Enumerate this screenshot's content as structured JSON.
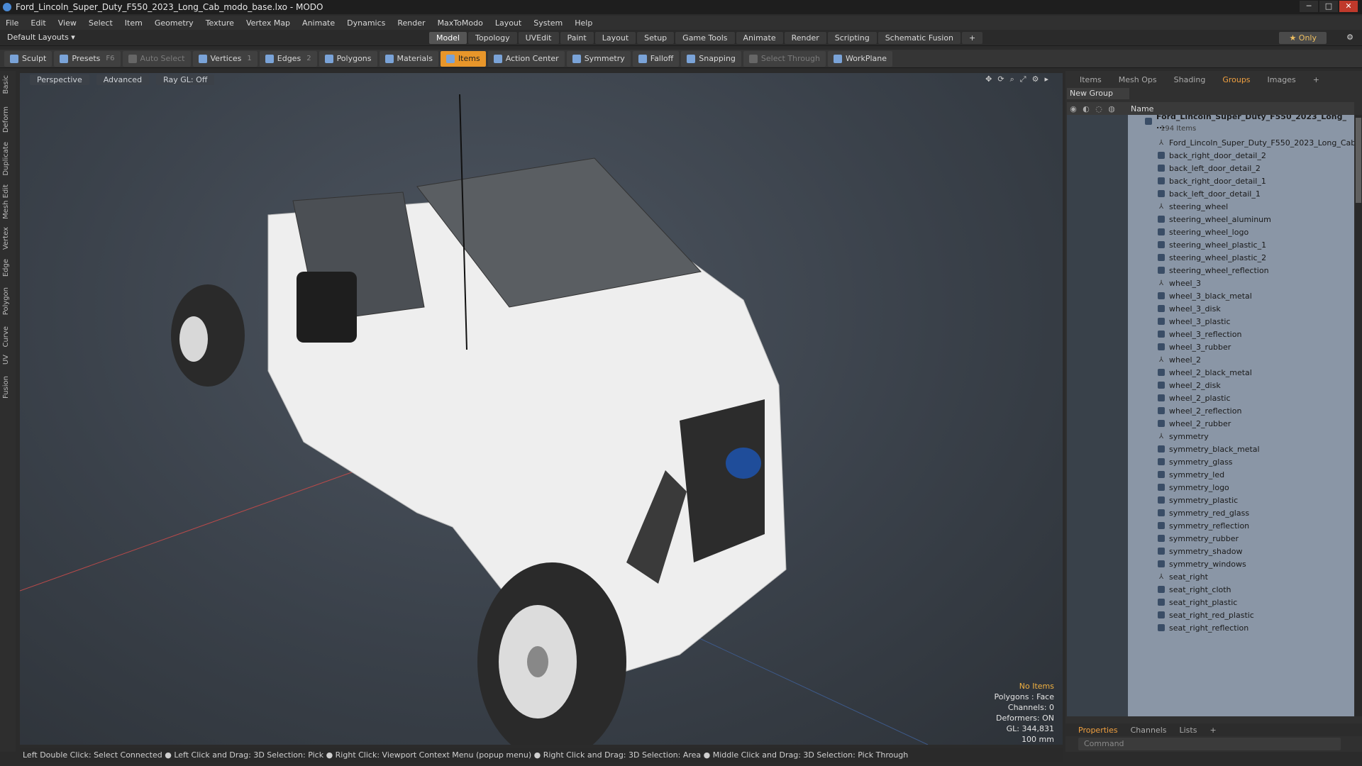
{
  "window": {
    "title": "Ford_Lincoln_Super_Duty_F550_2023_Long_Cab_modo_base.lxo - MODO"
  },
  "menu": [
    "File",
    "Edit",
    "View",
    "Select",
    "Item",
    "Geometry",
    "Texture",
    "Vertex Map",
    "Animate",
    "Dynamics",
    "Render",
    "MaxToModo",
    "Layout",
    "System",
    "Help"
  ],
  "layout": {
    "name": "Default Layouts ▾",
    "tabs": [
      "Model",
      "Topology",
      "UVEdit",
      "Paint",
      "Layout",
      "Setup",
      "Game Tools",
      "Animate",
      "Render",
      "Scripting",
      "Schematic Fusion",
      "+"
    ],
    "active": "Model",
    "only": "★ Only"
  },
  "toolbar": {
    "sculpt": "Sculpt",
    "presets": "Presets",
    "presets_key": "F6",
    "auto_select": "Auto Select",
    "vertices": "Vertices",
    "vertices_key": "1",
    "edges": "Edges",
    "edges_key": "2",
    "polygons": "Polygons",
    "materials": "Materials",
    "items": "Items",
    "action_center": "Action Center",
    "symmetry": "Symmetry",
    "falloff": "Falloff",
    "snapping": "Snapping",
    "select_through": "Select Through",
    "workplane": "WorkPlane"
  },
  "left_tabs": [
    "Basic",
    "Deform",
    "Duplicate",
    "Mesh Edit",
    "Vertex",
    "Edge",
    "Polygon",
    "Curve",
    "UV",
    "Fusion"
  ],
  "viewport": {
    "view": "Perspective",
    "shading": "Advanced",
    "raygl": "Ray GL: Off",
    "hud": {
      "sel": "No Items",
      "polys": "Polygons : Face",
      "channels": "Channels: 0",
      "deformers": "Deformers: ON",
      "gl": "GL: 344,831",
      "scale": "100 mm"
    }
  },
  "panel": {
    "tabs": [
      "Items",
      "Mesh Ops",
      "Shading",
      "Groups",
      "Images",
      "+"
    ],
    "active_tab": "Groups",
    "new_group": "New Group",
    "name_header": "Name",
    "root": {
      "name": "Ford_Lincoln_Super_Duty_F550_2023_Long_ ...",
      "count": "194 Items"
    },
    "items": [
      "Ford_Lincoln_Super_Duty_F550_2023_Long_Cab",
      "back_right_door_detail_2",
      "back_left_door_detail_2",
      "back_right_door_detail_1",
      "back_left_door_detail_1",
      "steering_wheel",
      "steering_wheel_aluminum",
      "steering_wheel_logo",
      "steering_wheel_plastic_1",
      "steering_wheel_plastic_2",
      "steering_wheel_reflection",
      "wheel_3",
      "wheel_3_black_metal",
      "wheel_3_disk",
      "wheel_3_plastic",
      "wheel_3_reflection",
      "wheel_3_rubber",
      "wheel_2",
      "wheel_2_black_metal",
      "wheel_2_disk",
      "wheel_2_plastic",
      "wheel_2_reflection",
      "wheel_2_rubber",
      "symmetry",
      "symmetry_black_metal",
      "symmetry_glass",
      "symmetry_led",
      "symmetry_logo",
      "symmetry_plastic",
      "symmetry_red_glass",
      "symmetry_reflection",
      "symmetry_rubber",
      "symmetry_shadow",
      "symmetry_windows",
      "seat_right",
      "seat_right_cloth",
      "seat_right_plastic",
      "seat_right_red_plastic",
      "seat_right_reflection"
    ],
    "props_tabs": [
      "Properties",
      "Channels",
      "Lists",
      "+"
    ],
    "command_placeholder": "Command"
  },
  "status": "Left Double Click: Select Connected ● Left Click and Drag: 3D Selection: Pick ● Right Click: Viewport Context Menu (popup menu) ● Right Click and Drag: 3D Selection: Area ● Middle Click and Drag: 3D Selection: Pick Through"
}
